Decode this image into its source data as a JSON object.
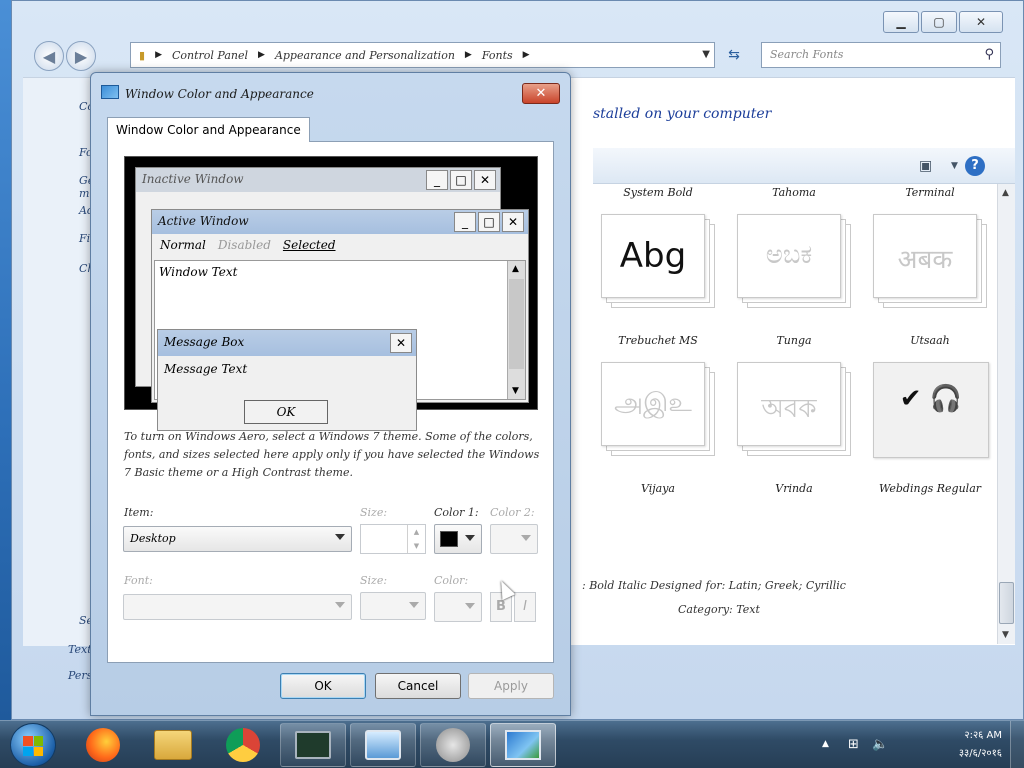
{
  "explorer": {
    "breadcrumb": [
      "Control Panel",
      "Appearance and Personalization",
      "Fonts"
    ],
    "search_placeholder": "Search Fonts",
    "heading": "stalled on your computer",
    "left_items": [
      "Contro",
      "Font",
      "Get m",
      "Adjus",
      "Find",
      "Chang"
    ],
    "lower_left": [
      "See a",
      "Text",
      "Perso"
    ],
    "fonts": [
      {
        "name": "System Bold",
        "glyph": ""
      },
      {
        "name": "Tahoma",
        "glyph": ""
      },
      {
        "name": "Terminal",
        "glyph": ""
      },
      {
        "name": "Trebuchet MS",
        "glyph": "Abg"
      },
      {
        "name": "Tunga",
        "glyph": "ಅಬಕ"
      },
      {
        "name": "Utsaah",
        "glyph": "अबक"
      },
      {
        "name": "Vijaya",
        "glyph": "அஇஉ"
      },
      {
        "name": "Vrinda",
        "glyph": "অবক"
      },
      {
        "name": "Webdings Regular",
        "glyph": "✔ 🎧"
      }
    ],
    "details_line1": ": Bold Italic    Designed for: Latin; Greek; Cyrillic",
    "details_line2": "Category: Text"
  },
  "dialog": {
    "title": "Window Color and Appearance",
    "tab": "Window Color and Appearance",
    "preview": {
      "inactive_title": "Inactive Window",
      "active_title": "Active Window",
      "menu": {
        "normal": "Normal",
        "disabled": "Disabled",
        "selected": "Selected"
      },
      "window_text": "Window Text",
      "message_title": "Message Box",
      "message_text": "Message Text",
      "ok": "OK"
    },
    "description": "To turn on Windows Aero, select a Windows 7 theme. Some of the colors, fonts, and sizes selected here apply only if you have selected the Windows 7 Basic theme or a High Contrast theme.",
    "labels": {
      "item": "Item:",
      "size": "Size:",
      "color1": "Color 1:",
      "color2": "Color 2:",
      "font": "Font:",
      "font_size": "Size:",
      "font_color": "Color:"
    },
    "item_value": "Desktop",
    "bold_glyph": "B",
    "italic_glyph": "I",
    "buttons": {
      "ok": "OK",
      "cancel": "Cancel",
      "apply": "Apply"
    }
  },
  "taskbar": {
    "clock_time": "२:२६ AM",
    "clock_date": "३३/६/२०१६"
  },
  "colors": {
    "accent": "#2e6fc4",
    "close": "#c9442b"
  }
}
